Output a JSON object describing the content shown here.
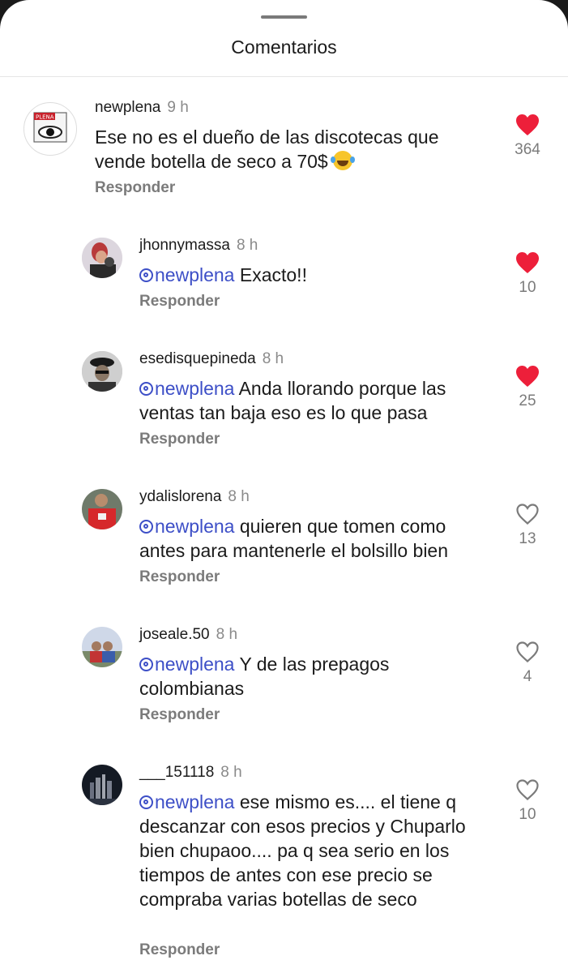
{
  "header": {
    "title": "Comentarios"
  },
  "reply_label": "Responder",
  "colors": {
    "like_active": "#ed1f3a",
    "mention": "#3d4fc7"
  },
  "comments": [
    {
      "user": "newplena",
      "time": "9 h",
      "text": "Ese no es el dueño de las discotecas que vende botella de seco a 70$",
      "emoji": "tears-of-joy-emoji",
      "likes": "364",
      "liked": true
    },
    {
      "user": "jhonnymassa",
      "time": "8 h",
      "mention": "newplena",
      "text": " Exacto!!",
      "likes": "10",
      "liked": true
    },
    {
      "user": "esedisquepineda",
      "time": "8 h",
      "mention": "newplena",
      "text": " Anda llorando porque las ventas tan baja eso es lo que pasa",
      "likes": "25",
      "liked": true
    },
    {
      "user": "ydalislorena",
      "time": "8 h",
      "mention": "newplena",
      "text": " quieren que tomen como antes para mantenerle el bolsillo bien",
      "likes": "13",
      "liked": false
    },
    {
      "user": "joseale.50",
      "time": "8 h",
      "mention": "newplena",
      "text": " Y de las prepagos colombianas",
      "likes": "4",
      "liked": false
    },
    {
      "user": "___151118",
      "time": "8 h",
      "mention": "newplena",
      "text": " ese mismo es.... el tiene q descanzar con esos precios y Chuparlo bien chupaoo.... pa q sea serio en los tiempos de antes con ese precio se compraba varias botellas de seco",
      "likes": "10",
      "liked": false
    }
  ]
}
